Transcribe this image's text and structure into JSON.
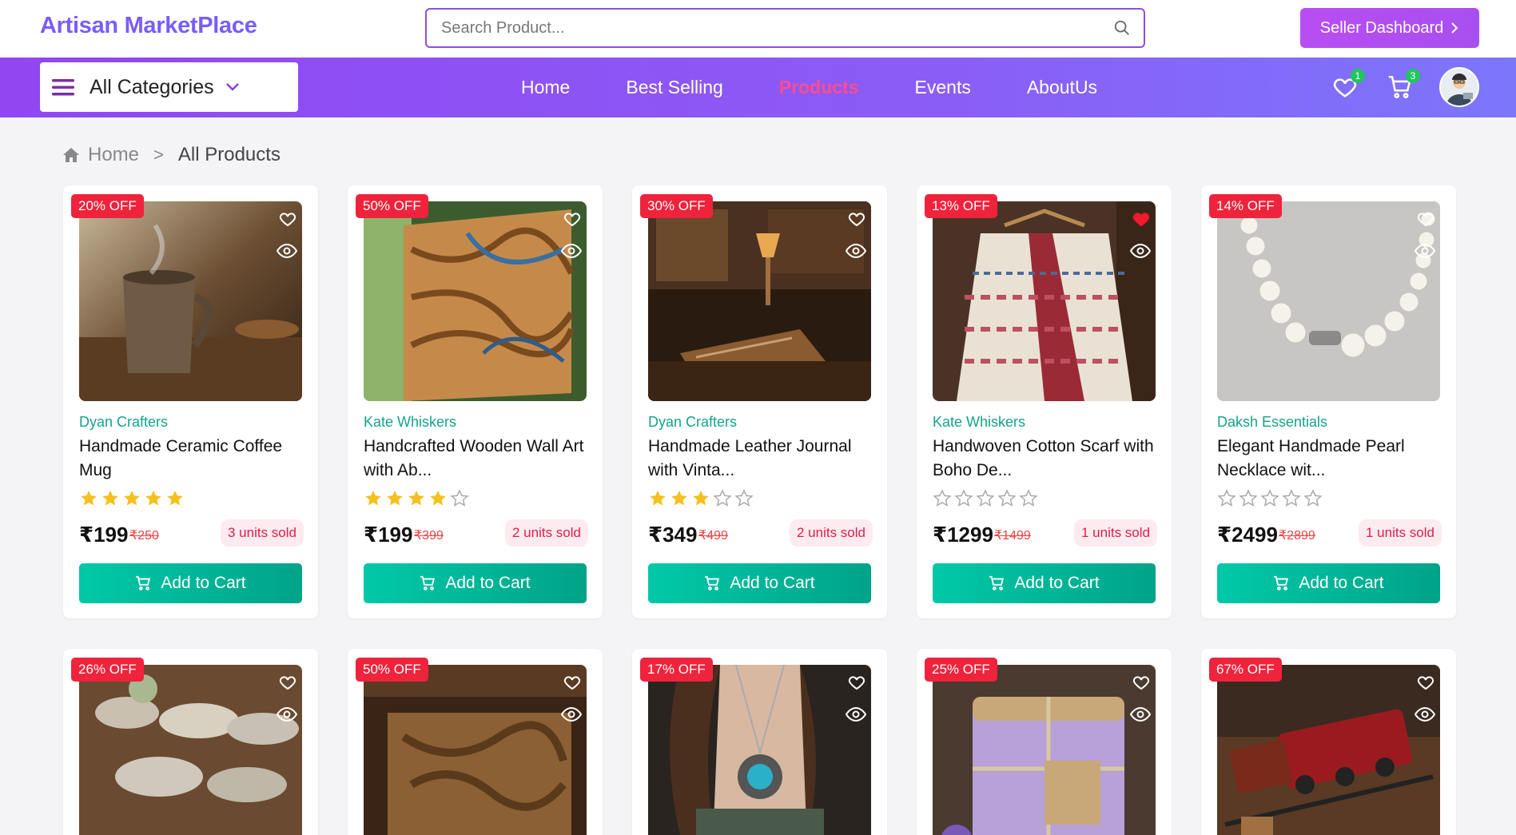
{
  "header": {
    "logo": "Artisan MarketPlace",
    "search_placeholder": "Search Product...",
    "seller_button": "Seller Dashboard"
  },
  "nav": {
    "categories_label": "All Categories",
    "links": [
      "Home",
      "Best Selling",
      "Products",
      "Events",
      "AboutUs"
    ],
    "active": "Products",
    "wishlist_count": "1",
    "cart_count": "3"
  },
  "breadcrumb": {
    "home": "Home",
    "current": "All Products"
  },
  "colors": {
    "brand": "#7b5cff",
    "accent_pink": "#ff4d8d",
    "cart": "#00b39b",
    "discount": "#ef233c",
    "nav_start": "#9146f2",
    "nav_end": "#7c76fb"
  },
  "products": [
    {
      "discount": "20% OFF",
      "seller": "Dyan Crafters",
      "name": "Handmade Ceramic Coffee Mug",
      "rating": 5,
      "price": "₹199",
      "old_price": "₹250",
      "sold": "3 units sold",
      "favorited": false,
      "add_label": "Add to Cart"
    },
    {
      "discount": "50% OFF",
      "seller": "Kate Whiskers",
      "name": "Handcrafted Wooden Wall Art with Ab...",
      "rating": 4,
      "price": "₹199",
      "old_price": "₹399",
      "sold": "2 units sold",
      "favorited": false,
      "add_label": "Add to Cart"
    },
    {
      "discount": "30% OFF",
      "seller": "Dyan Crafters",
      "name": "Handmade Leather Journal with Vinta...",
      "rating": 3,
      "price": "₹349",
      "old_price": "₹499",
      "sold": "2 units sold",
      "favorited": false,
      "add_label": "Add to Cart"
    },
    {
      "discount": "13% OFF",
      "seller": "Kate Whiskers",
      "name": "Handwoven Cotton Scarf with Boho De...",
      "rating": 0,
      "price": "₹1299",
      "old_price": "₹1499",
      "sold": "1 units sold",
      "favorited": true,
      "add_label": "Add to Cart"
    },
    {
      "discount": "14% OFF",
      "seller": "Daksh Essentials",
      "name": "Elegant Handmade Pearl Necklace wit...",
      "rating": 0,
      "price": "₹2499",
      "old_price": "₹2899",
      "sold": "1 units sold",
      "favorited": false,
      "add_label": "Add to Cart"
    },
    {
      "discount": "26% OFF",
      "favorited": false
    },
    {
      "discount": "50% OFF",
      "favorited": false
    },
    {
      "discount": "17% OFF",
      "favorited": false
    },
    {
      "discount": "25% OFF",
      "favorited": false
    },
    {
      "discount": "67% OFF",
      "favorited": false
    }
  ]
}
